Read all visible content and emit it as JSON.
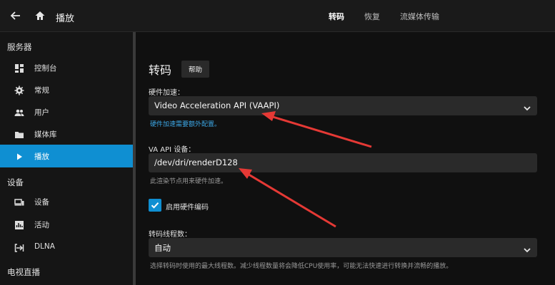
{
  "topbar": {
    "title": "播放",
    "tabs": [
      {
        "label": "转码",
        "active": true
      },
      {
        "label": "恢复",
        "active": false
      },
      {
        "label": "流媒体传输",
        "active": false
      }
    ],
    "icons": {
      "back": "back-arrow-icon",
      "home": "home-icon"
    }
  },
  "sidebar": {
    "sections": [
      {
        "title": "服务器",
        "items": [
          {
            "label": "控制台",
            "icon": "dashboard-icon"
          },
          {
            "label": "常规",
            "icon": "gear-icon"
          },
          {
            "label": "用户",
            "icon": "users-icon"
          },
          {
            "label": "媒体库",
            "icon": "folder-icon"
          },
          {
            "label": "播放",
            "icon": "play-icon",
            "active": true
          }
        ]
      },
      {
        "title": "设备",
        "items": [
          {
            "label": "设备",
            "icon": "devices-icon"
          },
          {
            "label": "活动",
            "icon": "activity-icon"
          },
          {
            "label": "DLNA",
            "icon": "dlna-icon"
          }
        ]
      },
      {
        "title": "电视直播",
        "items": []
      }
    ]
  },
  "main": {
    "heading": "转码",
    "help_label": "帮助",
    "hw_accel": {
      "label": "硬件加速：",
      "value": "Video Acceleration API (VAAPI)",
      "hint": "硬件加速需要额外配置。"
    },
    "va_device": {
      "label": "VA API 设备：",
      "value": "/dev/dri/renderD128",
      "hint": "此渲染节点用来硬件加速。"
    },
    "hw_encoding": {
      "label": "启用硬件编码",
      "checked": true
    },
    "threads": {
      "label": "转码线程数：",
      "value": "自动",
      "hint": "选择转码时使用的最大线程数。减少线程数量将会降低CPU使用率，可能无法快速进行转换并流畅的播放。"
    }
  },
  "colors": {
    "accent": "#0f8fd2",
    "annotation": "#e53935",
    "link": "#3ca7e6"
  }
}
